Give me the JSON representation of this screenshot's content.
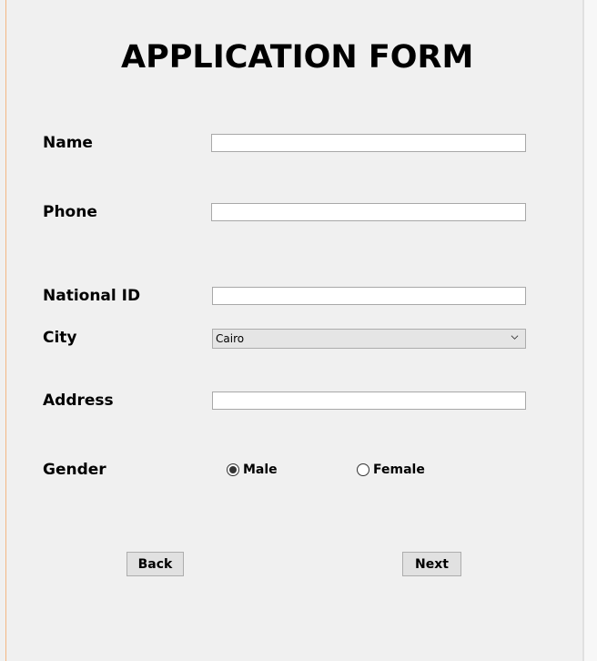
{
  "form": {
    "title": "APPLICATION FORM",
    "fields": {
      "name": {
        "label": "Name",
        "value": ""
      },
      "phone": {
        "label": "Phone",
        "value": ""
      },
      "national_id": {
        "label": "National ID",
        "value": ""
      },
      "city": {
        "label": "City",
        "value": "Cairo"
      },
      "address": {
        "label": "Address",
        "value": ""
      },
      "gender": {
        "label": "Gender",
        "options": [
          "Male",
          "Female"
        ],
        "selected": "Male"
      }
    },
    "buttons": {
      "back": "Back",
      "next": "Next"
    }
  }
}
